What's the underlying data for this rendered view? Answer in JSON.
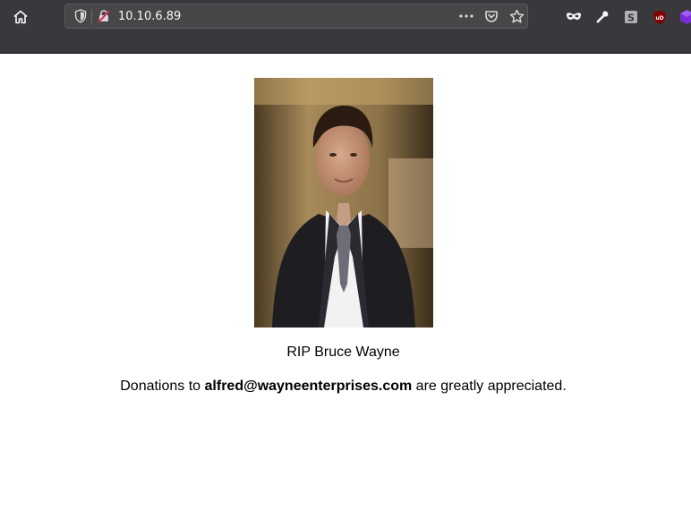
{
  "browser": {
    "url": "10.10.6.89",
    "icons": {
      "home": "home-icon",
      "tracking": "shield-icon",
      "insecure": "insecure-lock-icon",
      "page_actions": "more-icon",
      "pocket": "pocket-icon",
      "bookmark": "star-icon",
      "extensions": [
        "mask-icon",
        "wrench-icon",
        "s-extension-icon",
        "ublock-icon",
        "purple-extension-icon"
      ]
    },
    "ublock_label": "uD",
    "s_label": "S",
    "colors": {
      "toolbar": "#38383d",
      "urlbar": "#474749",
      "ublock": "#800000",
      "extension_purple": "#7b2bd9"
    }
  },
  "page": {
    "image": "bruce-wayne-portrait",
    "caption": "RIP Bruce Wayne",
    "donation_prefix": "Donations to ",
    "donation_email": "alfred@wayneenterprises.com",
    "donation_suffix": " are greatly appreciated."
  }
}
